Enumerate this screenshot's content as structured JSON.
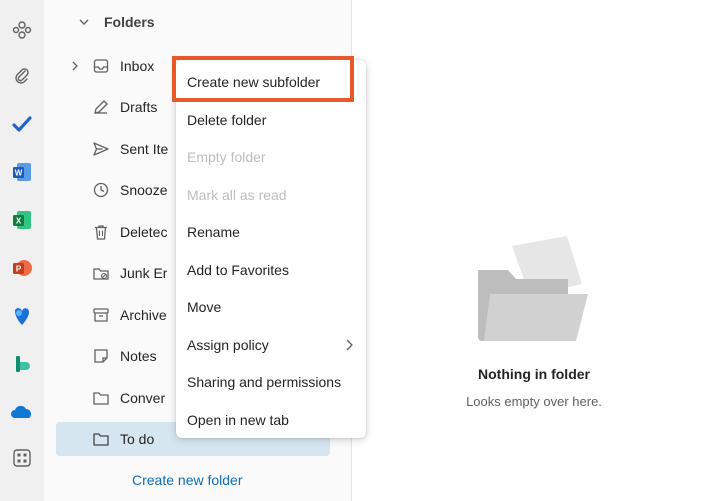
{
  "rail": {
    "items": [
      {
        "name": "groups-icon"
      },
      {
        "name": "attachment-icon"
      },
      {
        "name": "todo-check-icon"
      },
      {
        "name": "word-icon",
        "letter": "W"
      },
      {
        "name": "excel-icon",
        "letter": "X"
      },
      {
        "name": "powerpoint-icon",
        "letter": "P"
      },
      {
        "name": "teams-icon"
      },
      {
        "name": "bookings-icon"
      },
      {
        "name": "onedrive-icon"
      },
      {
        "name": "more-apps-icon"
      }
    ]
  },
  "folders": {
    "header": "Folders",
    "items": [
      {
        "label": "Inbox",
        "icon": "inbox-icon",
        "expandable": true
      },
      {
        "label": "Drafts",
        "icon": "drafts-icon"
      },
      {
        "label": "Sent Ite",
        "icon": "sent-icon"
      },
      {
        "label": "Snooze",
        "icon": "clock-icon"
      },
      {
        "label": "Deletec",
        "icon": "trash-icon"
      },
      {
        "label": "Junk Er",
        "icon": "junk-icon"
      },
      {
        "label": "Archive",
        "icon": "archive-icon"
      },
      {
        "label": "Notes",
        "icon": "notes-icon"
      },
      {
        "label": "Conver",
        "icon": "folder-icon"
      },
      {
        "label": "To do",
        "icon": "folder-icon",
        "selected": true
      }
    ],
    "create_new_folder": "Create new folder"
  },
  "context_menu": {
    "items": [
      {
        "label": "Create new subfolder",
        "highlighted": true
      },
      {
        "label": "Delete folder"
      },
      {
        "label": "Empty folder",
        "disabled": true
      },
      {
        "label": "Mark all as read",
        "disabled": true
      },
      {
        "label": "Rename"
      },
      {
        "label": "Add to Favorites"
      },
      {
        "label": "Move"
      },
      {
        "label": "Assign policy",
        "submenu": true
      },
      {
        "label": "Sharing and permissions"
      },
      {
        "label": "Open in new tab"
      }
    ]
  },
  "empty_state": {
    "title": "Nothing in folder",
    "subtitle": "Looks empty over here."
  },
  "colors": {
    "accent": "#0f6cbd",
    "highlight_border": "#e8592a",
    "selected_bg": "#d6e6f0"
  }
}
